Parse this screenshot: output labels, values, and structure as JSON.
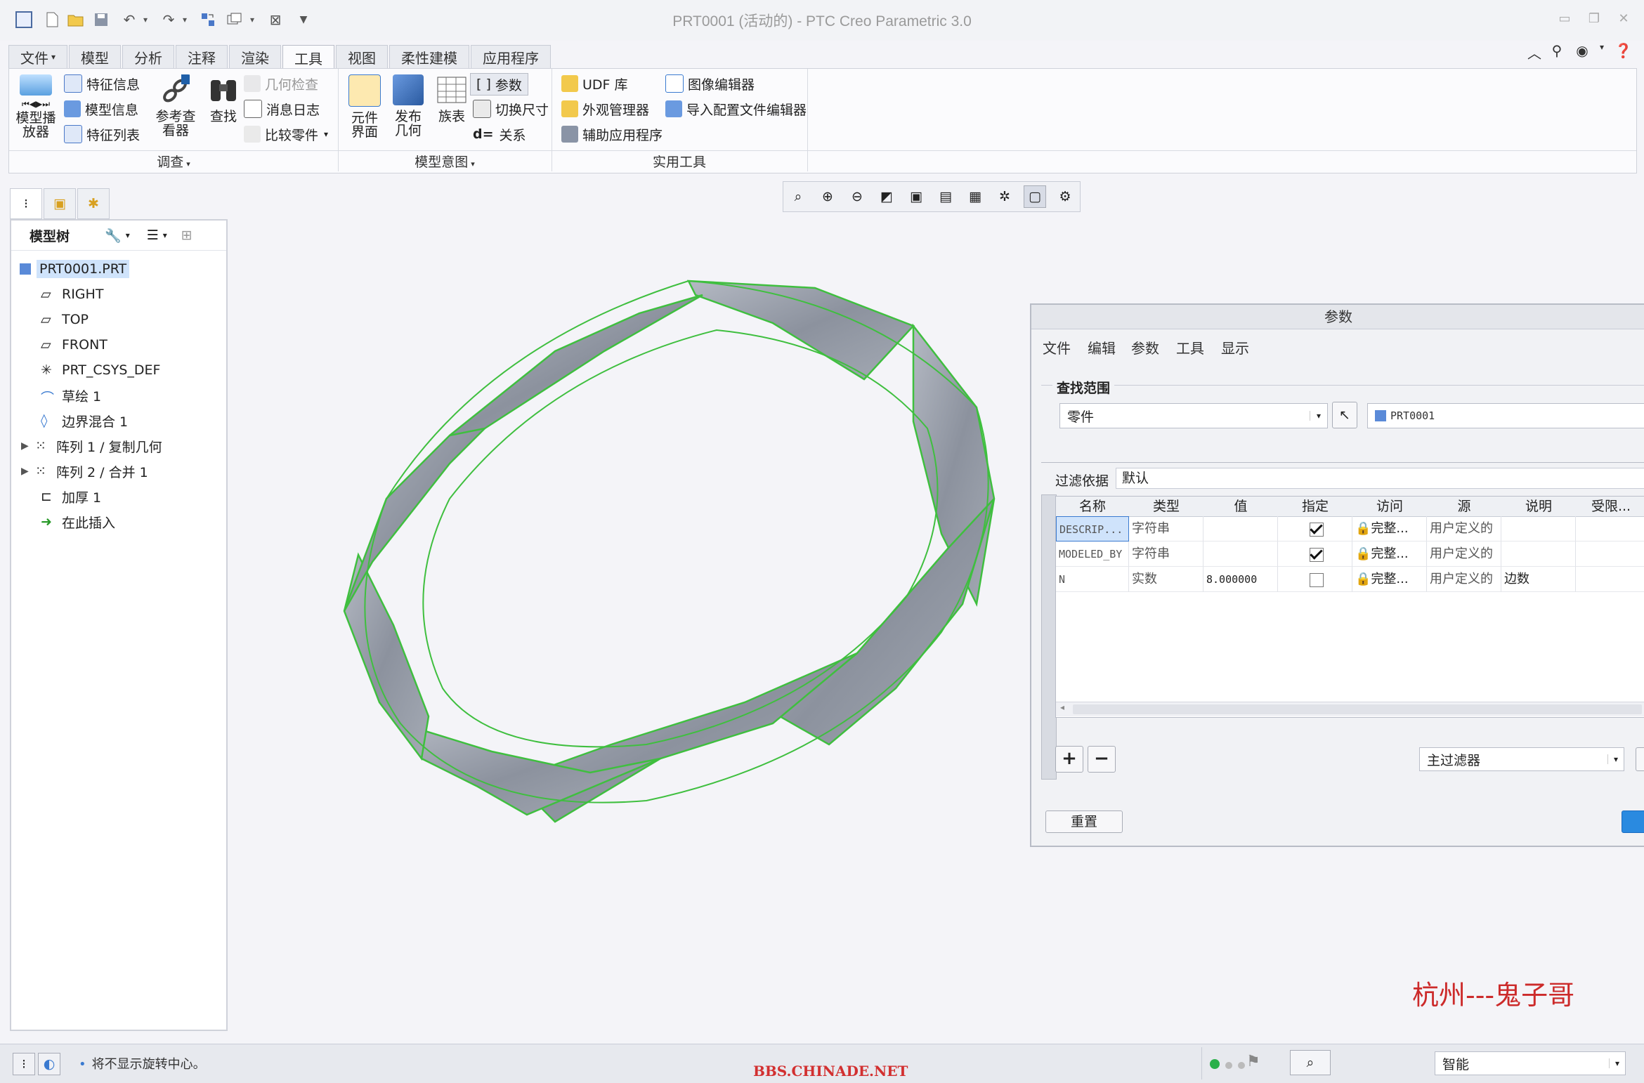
{
  "window": {
    "title": "PRT0001 (活动的) - PTC Creo Parametric 3.0"
  },
  "tabs": [
    {
      "label": "文件",
      "active": false
    },
    {
      "label": "模型",
      "active": false
    },
    {
      "label": "分析",
      "active": false
    },
    {
      "label": "注释",
      "active": false
    },
    {
      "label": "渲染",
      "active": false
    },
    {
      "label": "工具",
      "active": true
    },
    {
      "label": "视图",
      "active": false
    },
    {
      "label": "柔性建模",
      "active": false
    },
    {
      "label": "应用程序",
      "active": false
    }
  ],
  "ribbon": {
    "groups": [
      "调查",
      "模型意图",
      "实用工具"
    ],
    "investigate": {
      "model_player": "模型播\n放器",
      "feature_info": "特征信息",
      "model_info": "模型信息",
      "feature_list": "特征列表",
      "reference_viewer": "参考查\n看器",
      "find": "查找",
      "geometry_check": "几何检查",
      "message_log": "消息日志",
      "compare_part": "比较零件"
    },
    "model_intent": {
      "component_interface": "元件\n界面",
      "publish_geometry": "发布\n几何",
      "family_table": "族表",
      "parameters": "参数",
      "switch_dimensions": "切换尺寸",
      "relations": "关系",
      "relations_prefix": "d="
    },
    "utilities": {
      "udf_library": "UDF 库",
      "appearance_manager": "外观管理器",
      "auxiliary_app": "辅助应用程序",
      "image_editor": "图像编辑器",
      "import_config_editor": "导入配置文件编辑器"
    }
  },
  "model_tree": {
    "header": "模型树",
    "nodes": [
      {
        "label": "PRT0001.PRT",
        "selected": true
      },
      {
        "label": "RIGHT"
      },
      {
        "label": "TOP"
      },
      {
        "label": "FRONT"
      },
      {
        "label": "PRT_CSYS_DEF"
      },
      {
        "label": "草绘 1"
      },
      {
        "label": "边界混合 1"
      },
      {
        "label": "阵列 1 / 复制几何"
      },
      {
        "label": "阵列 2 / 合并 1"
      },
      {
        "label": "加厚 1"
      },
      {
        "label": "在此插入"
      }
    ]
  },
  "dialog": {
    "title": "参数",
    "menu": [
      "文件",
      "编辑",
      "参数",
      "工具",
      "显示"
    ],
    "lookin_label": "查找范围",
    "scope_value": "零件",
    "object_value": "PRT0001",
    "filter_label": "过滤依据",
    "filter_value": "默认",
    "columns": [
      "名称",
      "类型",
      "值",
      "指定",
      "访问",
      "源",
      "说明",
      "受限..."
    ],
    "rows": [
      {
        "name": "DESCRIP...",
        "type": "字符串",
        "value": "",
        "designated": true,
        "access": "完整...",
        "source": "用户定义的",
        "desc": ""
      },
      {
        "name": "MODELED_BY",
        "type": "字符串",
        "value": "",
        "designated": true,
        "access": "完整...",
        "source": "用户定义的",
        "desc": ""
      },
      {
        "name": "N",
        "type": "实数",
        "value": "8.000000",
        "designated": false,
        "access": "完整...",
        "source": "用户定义的",
        "desc": "边数"
      }
    ],
    "add_label": "+",
    "remove_label": "−",
    "main_filter": "主过滤器",
    "reset_label": "重置"
  },
  "watermark": {
    "author": "杭州---鬼子哥",
    "site": "BBS.CHINADE.NET"
  },
  "status": {
    "message": "将不显示旋转中心。",
    "mode": "智能"
  },
  "colors": {
    "accent": "#2a6fc9",
    "tab_active_bg": "#fbfbfd",
    "model_edge": "#3fbf3f",
    "model_fill": "#9aa0ab",
    "watermark_red": "#cc2a2a"
  }
}
